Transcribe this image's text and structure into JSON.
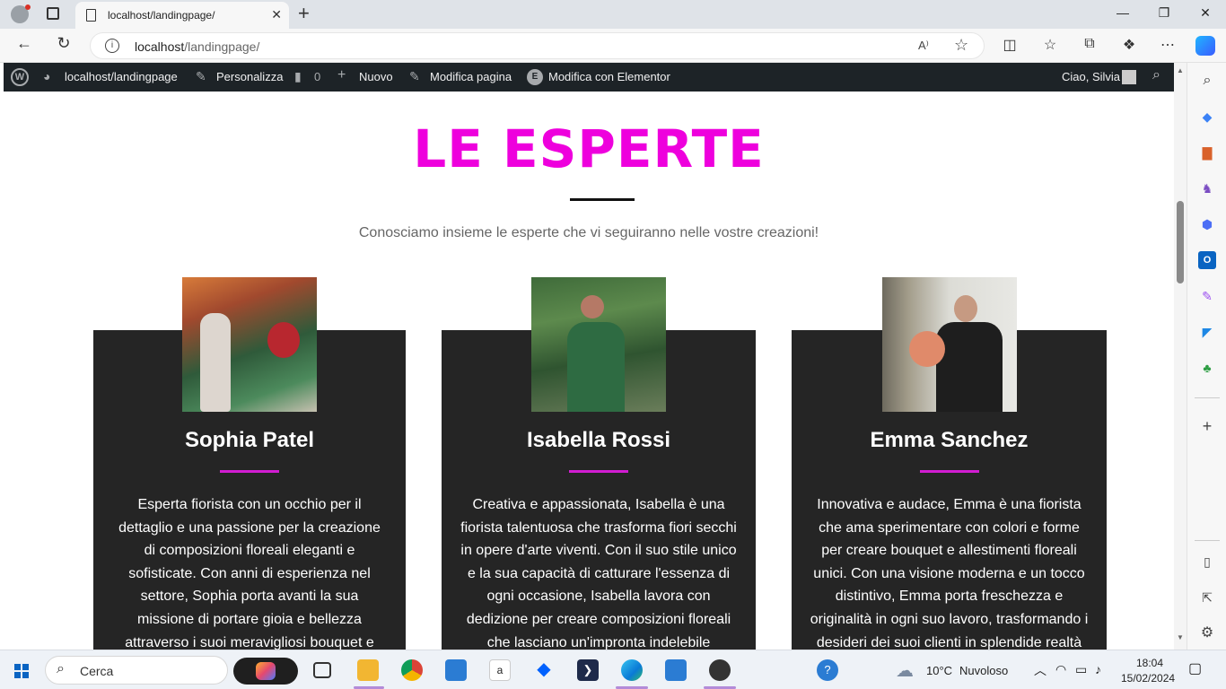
{
  "browser": {
    "tab_title": "localhost/landingpage/",
    "url_host": "localhost",
    "url_path": "/landingpage/",
    "new_tab_label": "+"
  },
  "admin_bar": {
    "site": "localhost/landingpage",
    "customize": "Personalizza",
    "comments_count": "0",
    "new": "Nuovo",
    "edit_page": "Modifica pagina",
    "edit_elementor": "Modifica con Elementor",
    "greeting": "Ciao, Silvia"
  },
  "page": {
    "heading": "LE ESPERTE",
    "subtitle": "Conosciamo insieme le esperte che vi seguiranno nelle vostre creazioni!",
    "accent_color": "#ee00dd",
    "experts": [
      {
        "name": "Sophia Patel",
        "bio": "Esperta fiorista con un occhio per il dettaglio e una passione per la creazione di composizioni floreali eleganti e sofisticate. Con anni di esperienza nel settore, Sophia porta avanti la sua missione di portare gioia e bellezza attraverso i suoi meravigliosi bouquet e"
      },
      {
        "name": "Isabella Rossi",
        "bio": "Creativa e appassionata, Isabella è una fiorista talentuosa che trasforma fiori secchi in opere d'arte viventi. Con il suo stile unico e la sua capacità di catturare l'essenza di ogni occasione, Isabella lavora con dedizione per creare composizioni floreali che lasciano un'impronta indelebile"
      },
      {
        "name": "Emma Sanchez",
        "bio": "Innovativa e audace, Emma è una fiorista che ama sperimentare con colori e forme per creare bouquet e allestimenti floreali unici. Con una visione moderna e un tocco distintivo, Emma porta freschezza e originalità in ogni suo lavoro, trasformando i desideri dei suoi clienti in splendide realtà"
      }
    ]
  },
  "taskbar": {
    "search_label": "Cerca",
    "weather_temp": "10°C",
    "weather_desc": "Nuvoloso",
    "time": "18:04",
    "date": "15/02/2024"
  }
}
